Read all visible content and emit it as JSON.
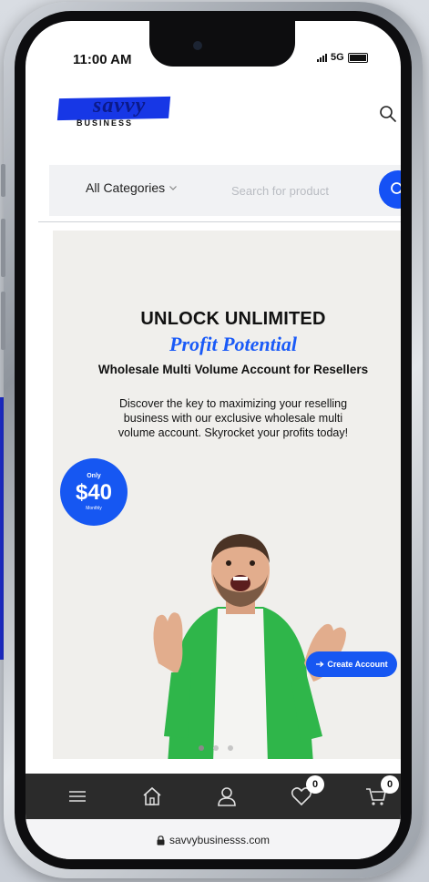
{
  "status_bar": {
    "time": "11:00 AM",
    "network": "5G"
  },
  "header": {
    "logo_script": "savvy",
    "logo_sub": "BUSINESS",
    "search_icon": "search-icon"
  },
  "search": {
    "category_label": "All Categories",
    "placeholder": "Search for product",
    "button_icon": "search-icon"
  },
  "banner": {
    "heading": "UNLOCK UNLIMITED",
    "script_heading": "Profit Potential",
    "subheading": "Wholesale Multi Volume Account for Resellers",
    "description": "Discover the key to maximizing your reselling business with our exclusive wholesale multi volume account. Skyrocket your profits today!",
    "price_only": "Only",
    "price_amount": "$40",
    "price_period": "Monthly",
    "cta_label": "Create Account",
    "cta_icon": "arrow-right-icon",
    "carousel_dots": 3,
    "carousel_active": 1
  },
  "bottom_nav": {
    "items": [
      {
        "icon": "menu-icon"
      },
      {
        "icon": "home-icon"
      },
      {
        "icon": "user-icon"
      },
      {
        "icon": "heart-icon",
        "badge": "0"
      },
      {
        "icon": "cart-icon",
        "badge": "0"
      }
    ]
  },
  "browser": {
    "url": "savvybusinesss.com"
  },
  "colors": {
    "accent": "#1657f2",
    "nav_bg": "#2b2b2b",
    "banner_bg": "#f0efec"
  }
}
